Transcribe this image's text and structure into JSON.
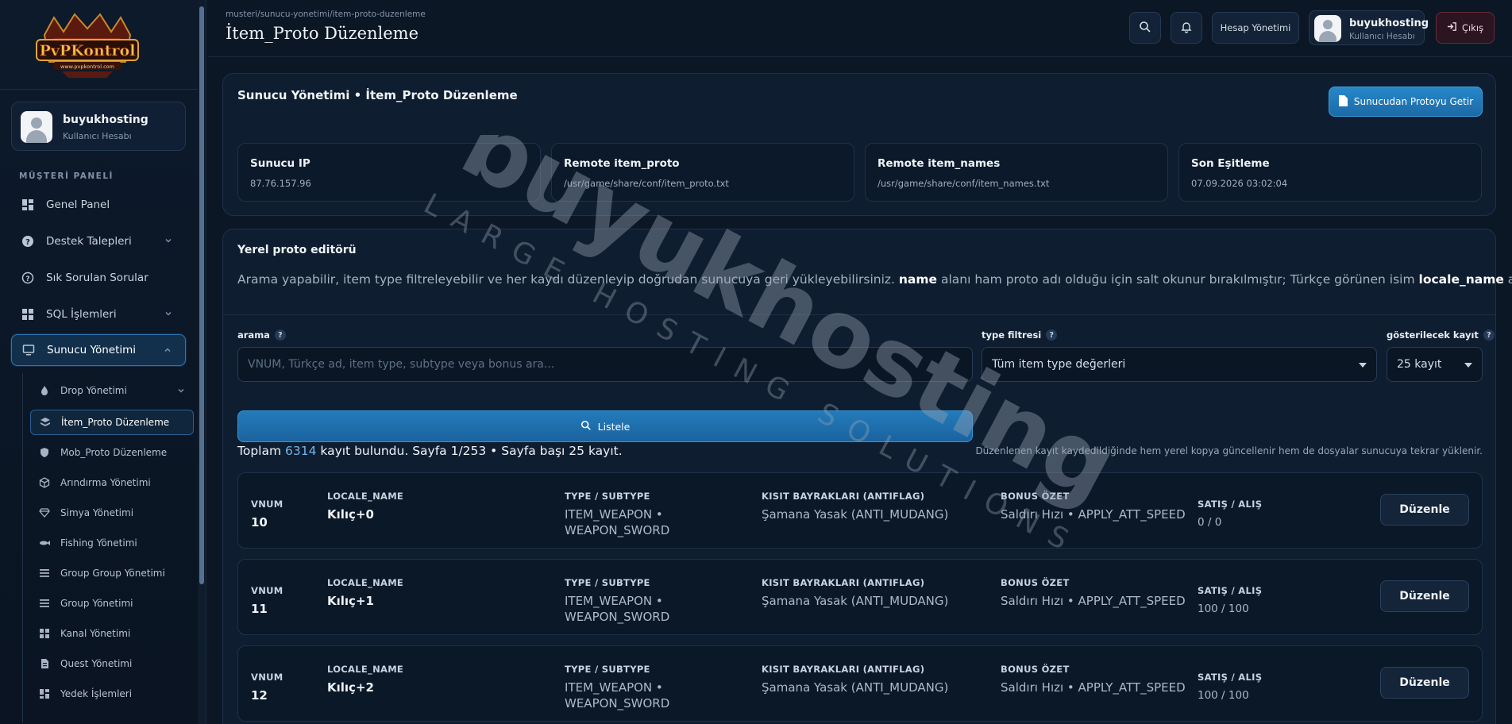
{
  "brand": {
    "logo_text": "PvPKontrol",
    "logo_url": "www.pvpkontrol.com"
  },
  "sidebar": {
    "user": {
      "name": "buyukhosting",
      "role": "Kullanıcı Hesabı"
    },
    "section_label": "MÜŞTERİ PANELİ",
    "items": [
      {
        "label": "Genel Panel",
        "icon": "dashboard-icon"
      },
      {
        "label": "Destek Talepleri",
        "icon": "support-icon"
      },
      {
        "label": "Sık Sorulan Sorular",
        "icon": "question-icon"
      },
      {
        "label": "SQL İşlemleri",
        "icon": "database-icon"
      },
      {
        "label": "Sunucu Yönetimi",
        "icon": "server-icon"
      }
    ],
    "sub_items": [
      {
        "label": "Drop Yönetimi",
        "icon": "flame-icon"
      },
      {
        "label": "İtem_Proto Düzenleme",
        "icon": "layers-icon"
      },
      {
        "label": "Mob_Proto Düzenleme",
        "icon": "shield-icon"
      },
      {
        "label": "Arındırma Yönetimi",
        "icon": "cube-icon"
      },
      {
        "label": "Simya Yönetimi",
        "icon": "gem-icon"
      },
      {
        "label": "Fishing Yönetimi",
        "icon": "fish-icon"
      },
      {
        "label": "Group Group Yönetimi",
        "icon": "list-icon"
      },
      {
        "label": "Group Yönetimi",
        "icon": "list-icon"
      },
      {
        "label": "Kanal Yönetimi",
        "icon": "grid-icon"
      },
      {
        "label": "Quest Yönetimi",
        "icon": "file-icon"
      },
      {
        "label": "Yedek İşlemleri",
        "icon": "dashboard-icon"
      }
    ]
  },
  "topbar": {
    "breadcrumb": "musteri/sunucu-yonetimi/item-proto-duzenleme",
    "title": "İtem_Proto Düzenleme",
    "account_btn": "Hesap Yönetimi",
    "user": {
      "name": "buyukhosting",
      "role": "Kullanıcı Hesabı"
    },
    "logout": "Çıkış"
  },
  "server_card": {
    "title": "Sunucu Yönetimi • İtem_Proto Düzenleme",
    "fetch_btn": "Sunucudan Protoyu Getir",
    "info": [
      {
        "label": "Sunucu IP",
        "value": "87.76.157.96"
      },
      {
        "label": "Remote item_proto",
        "value": "/usr/game/share/conf/item_proto.txt"
      },
      {
        "label": "Remote item_names",
        "value": "/usr/game/share/conf/item_names.txt"
      },
      {
        "label": "Son Eşitleme",
        "value": "07.09.2026 03:02:04"
      }
    ]
  },
  "editor": {
    "title": "Yerel proto editörü",
    "desc_a": "Arama yapabilir, item type filtreleyebilir ve her kaydı düzenleyip doğrudan sunucuya geri yükleyebilirsiniz. ",
    "desc_b": "name",
    "desc_c": " alanı ham proto adı olduğu için salt okunur bırakılmıştır; Türkçe görünen isim ",
    "desc_d": "locale_name",
    "desc_e": " alanıdır.",
    "search": {
      "label": "arama",
      "placeholder": "VNUM, Türkçe ad, item type, subtype veya bonus ara..."
    },
    "type_filter": {
      "label": "type filtresi",
      "value": "Tüm item type değerleri"
    },
    "page_size": {
      "label": "gösterilecek kayıt",
      "value": "25 kayıt"
    },
    "help_mark": "?",
    "list_btn": "Listele",
    "summary_a": "Toplam ",
    "summary_num": "6314",
    "summary_b": " kayıt bulundu. Sayfa 1/253 • Sayfa başı 25 kayıt.",
    "note": "Düzenlenen kayıt kaydedildiğinde hem yerel kopya güncellenir hem de dosyalar sunucuya tekrar yüklenir."
  },
  "columns": {
    "vnum": "VNUM",
    "locale": "LOCALE_NAME",
    "type": "TYPE / SUBTYPE",
    "flags": "KISIT BAYRAKLARI (ANTIFLAG)",
    "bonus": "BONUS ÖZET",
    "price": "SATIŞ / ALIŞ",
    "edit": "Düzenle"
  },
  "rows": [
    {
      "vnum": "10",
      "locale": "Kılıç+0",
      "type1": "ITEM_WEAPON •",
      "type2": "WEAPON_SWORD",
      "flags": "Şamana Yasak (ANTI_MUDANG)",
      "bonus": "Saldırı Hızı • APPLY_ATT_SPEED",
      "price": "0 / 0"
    },
    {
      "vnum": "11",
      "locale": "Kılıç+1",
      "type1": "ITEM_WEAPON •",
      "type2": "WEAPON_SWORD",
      "flags": "Şamana Yasak (ANTI_MUDANG)",
      "bonus": "Saldırı Hızı • APPLY_ATT_SPEED",
      "price": "100 / 100"
    },
    {
      "vnum": "12",
      "locale": "Kılıç+2",
      "type1": "ITEM_WEAPON •",
      "type2": "WEAPON_SWORD",
      "flags": "Şamana Yasak (ANTI_MUDANG)",
      "bonus": "Saldırı Hızı • APPLY_ATT_SPEED",
      "price": "100 / 100"
    }
  ],
  "watermark": {
    "main": "buyukhosting",
    "sub": "LARGE HOSTING SOLUTIONS"
  },
  "colors": {
    "accent": "#2787c9",
    "background": "#0c1726",
    "card": "#0f1d30",
    "logout": "#6a2a38"
  }
}
